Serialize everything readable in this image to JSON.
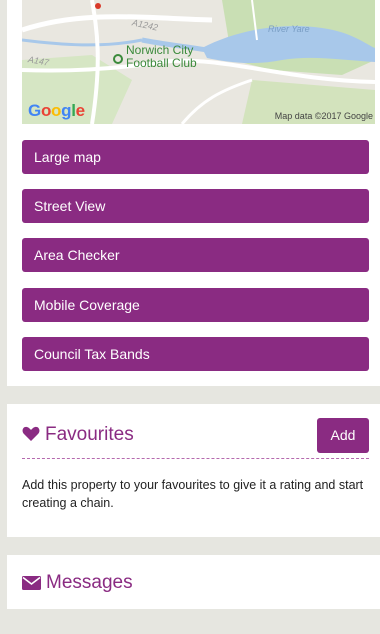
{
  "map": {
    "roads": [
      "A1242",
      "A147"
    ],
    "river": "River Yare",
    "poi": [
      "Norwich City",
      "Football Club"
    ],
    "logo_letters": [
      "G",
      "o",
      "o",
      "g",
      "l",
      "e"
    ],
    "logo_colors": [
      "#4285f4",
      "#ea4335",
      "#fbbc05",
      "#4285f4",
      "#34a853",
      "#ea4335"
    ],
    "credit": "Map data ©2017 Google"
  },
  "actions": [
    {
      "label": "Large map"
    },
    {
      "label": "Street View"
    },
    {
      "label": "Area Checker"
    },
    {
      "label": "Mobile Coverage"
    },
    {
      "label": "Council Tax Bands"
    }
  ],
  "favourites": {
    "title": "Favourites",
    "add_label": "Add",
    "description": "Add this property to your favourites to give it a rating and start creating a chain."
  },
  "messages": {
    "title": "Messages"
  },
  "colors": {
    "accent": "#8a2b82",
    "page_bg": "#e6e6e0"
  }
}
